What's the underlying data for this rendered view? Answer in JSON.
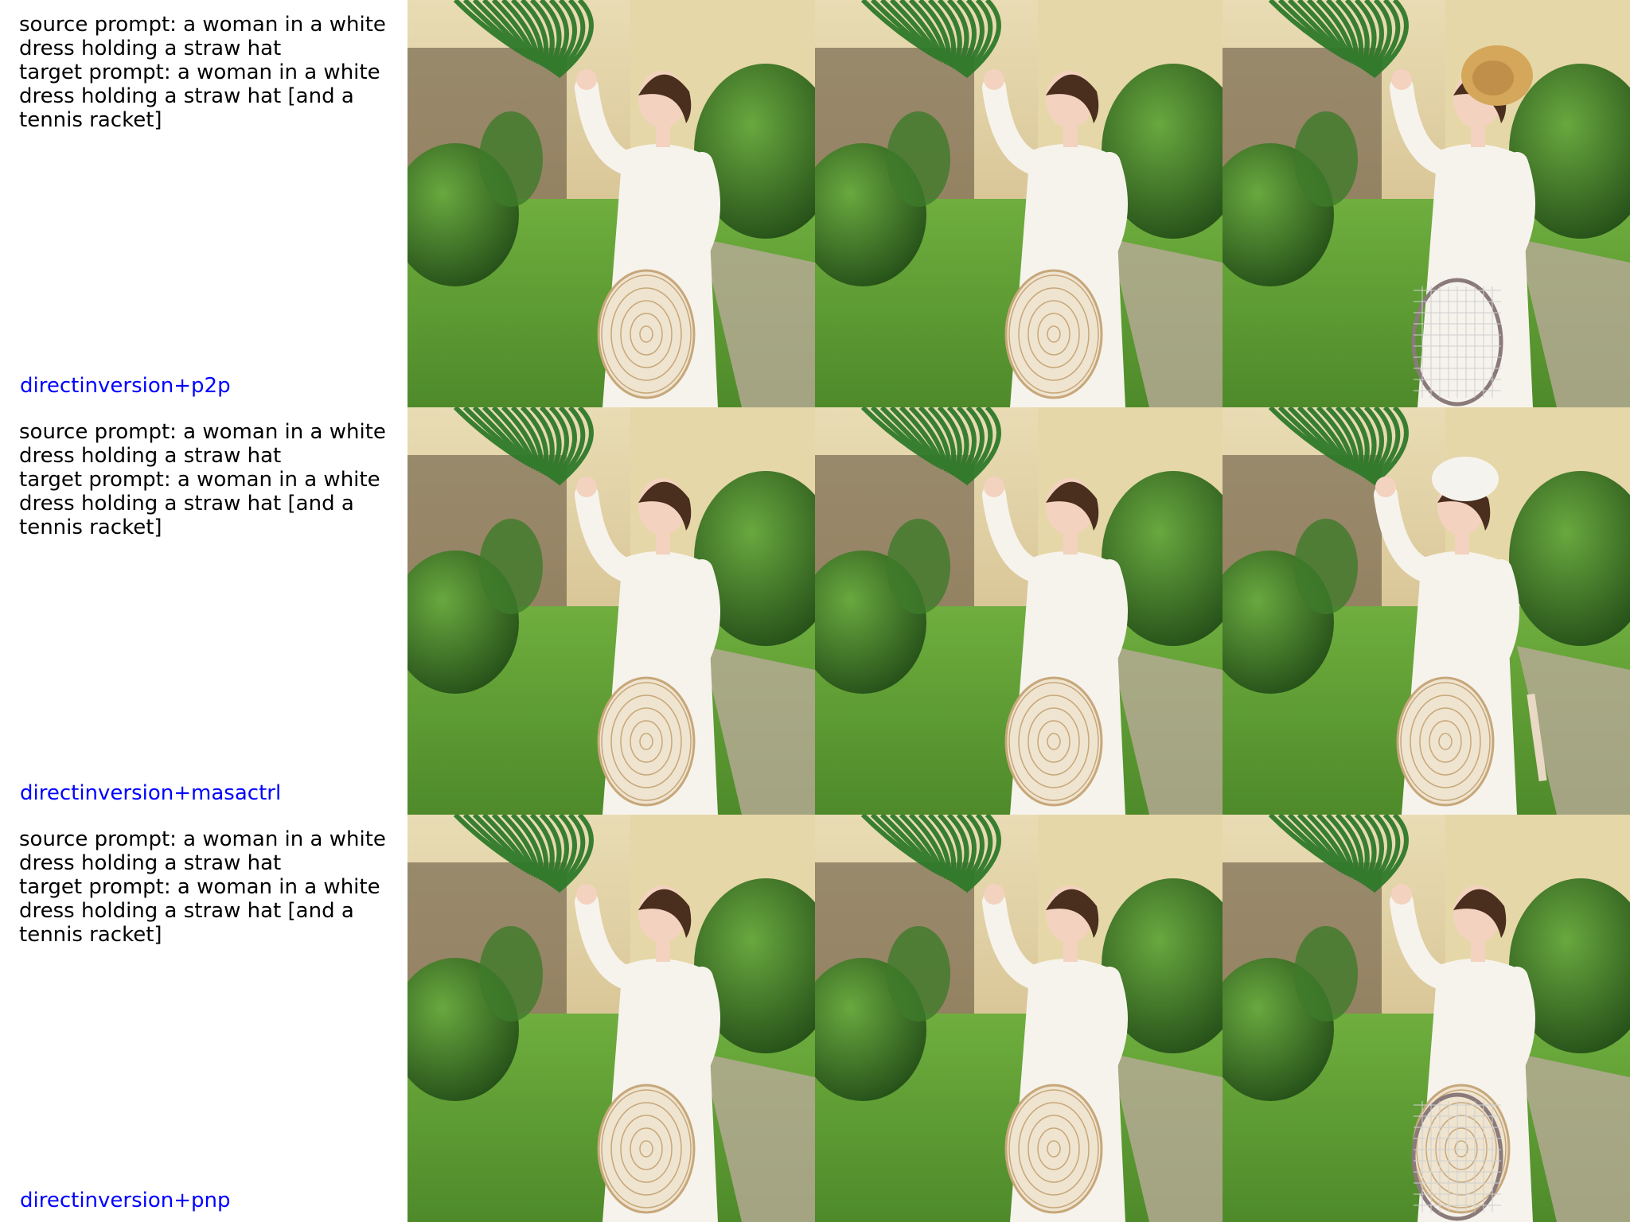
{
  "rows": [
    {
      "source_prompt": "source prompt: a woman in a white dress holding a straw hat",
      "target_prompt": "target prompt: a woman in a white dress holding a straw hat [and a tennis racket]",
      "method": "directinversion+p2p",
      "images": [
        {
          "content": "woman in white dress holding straw hat in garden",
          "variant": "source"
        },
        {
          "content": "woman in white dress holding straw hat in garden",
          "variant": "reconstruction"
        },
        {
          "content": "woman in white dress wearing straw hat holding tennis racket",
          "variant": "edit-racket-hat"
        }
      ]
    },
    {
      "source_prompt": "source prompt: a woman in a white dress holding a straw hat",
      "target_prompt": "target prompt: a woman in a white dress holding a straw hat [and a tennis racket]",
      "method": "directinversion+masactrl",
      "images": [
        {
          "content": "woman in white dress holding straw hat in garden",
          "variant": "source"
        },
        {
          "content": "woman in white dress holding straw hat in garden",
          "variant": "reconstruction"
        },
        {
          "content": "woman in white dress with white cap holding hat and racket handle",
          "variant": "edit-masactrl"
        }
      ]
    },
    {
      "source_prompt": "source prompt: a woman in a white dress holding a straw hat",
      "target_prompt": "target prompt: a woman in a white dress holding a straw hat [and a tennis racket]",
      "method": "directinversion+pnp",
      "images": [
        {
          "content": "woman in white dress holding straw hat in garden",
          "variant": "source"
        },
        {
          "content": "woman in white dress holding straw hat in garden",
          "variant": "reconstruction"
        },
        {
          "content": "woman in white dress holding tennis racket in garden",
          "variant": "edit-racket"
        }
      ]
    }
  ],
  "colors": {
    "grass": "#5a9a32",
    "hedge": "#2f6b22",
    "wall": "#d8b870",
    "dress": "#f6f3ec",
    "skin": "#f3d2bf",
    "hair": "#4a2e1e",
    "method_label": "#0000ff"
  }
}
